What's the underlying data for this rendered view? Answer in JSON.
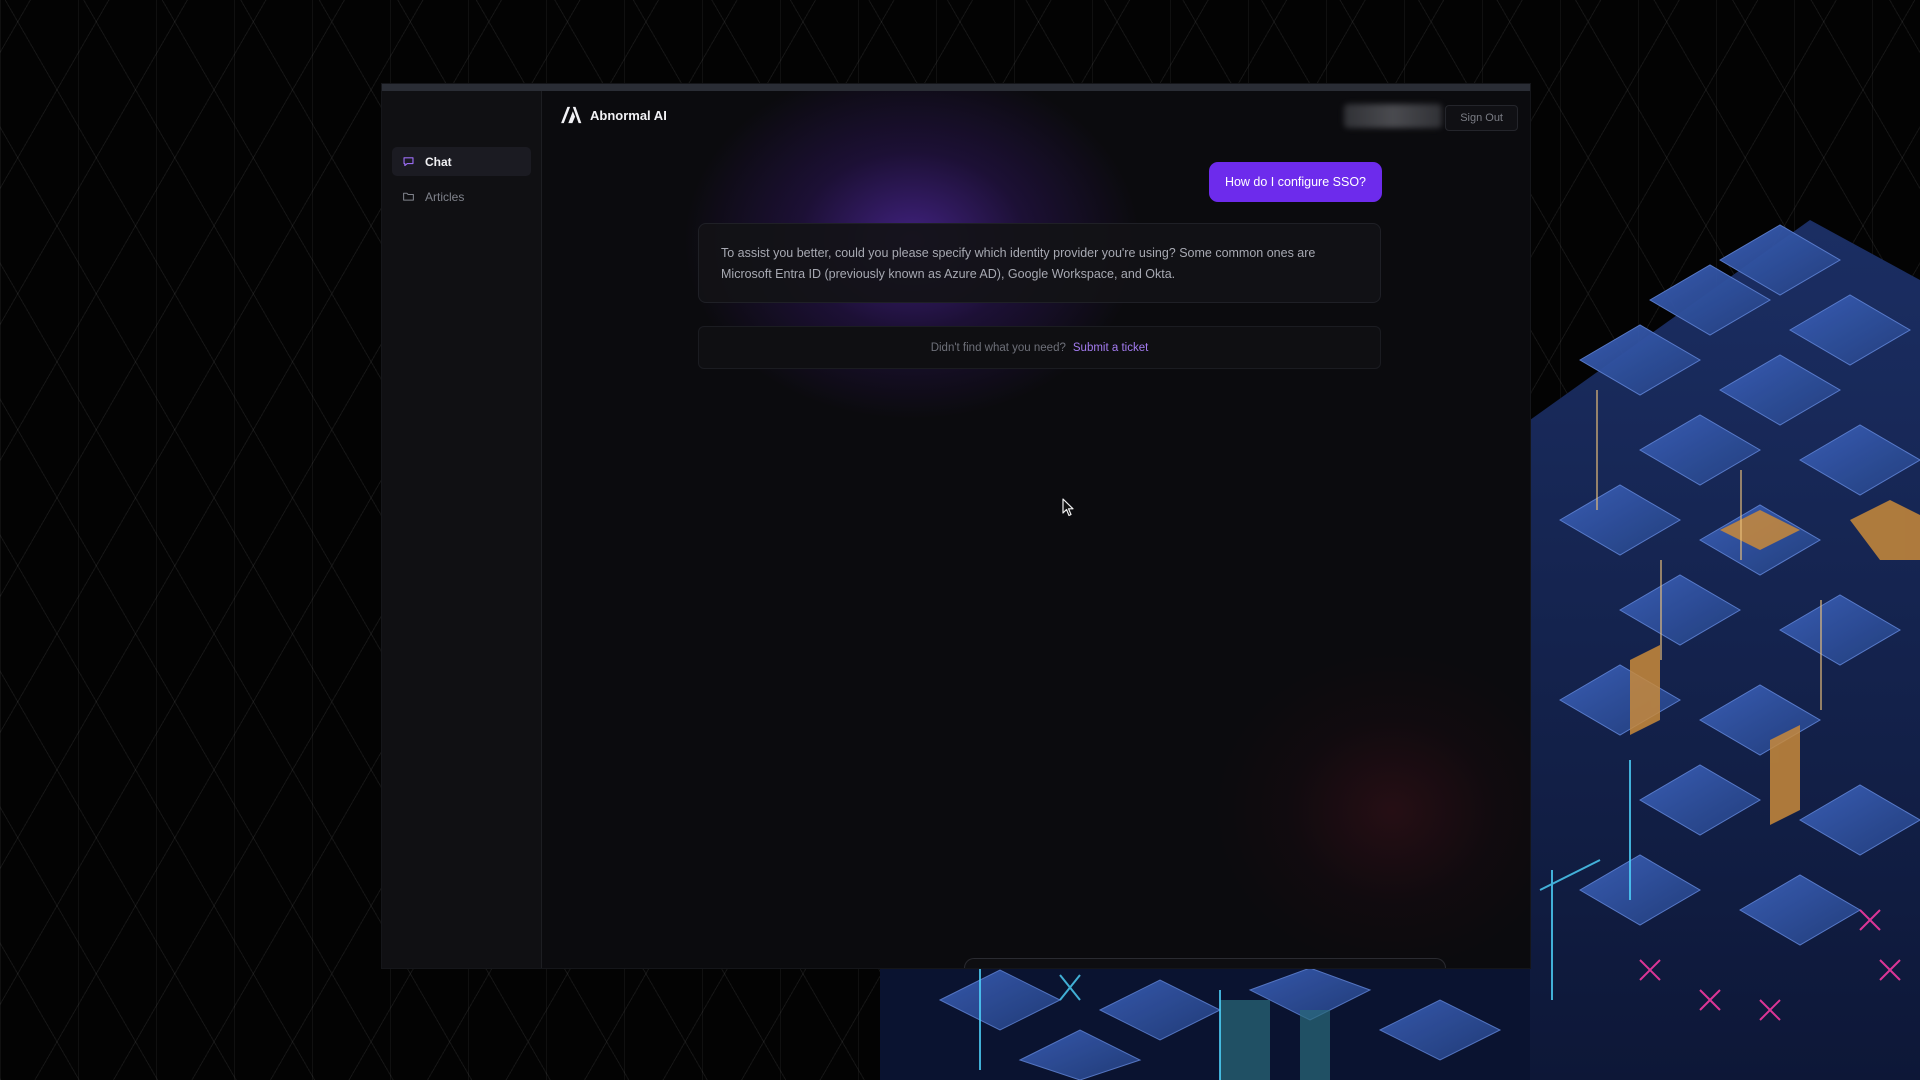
{
  "app": {
    "brand_name": "Abnormal AI",
    "accent_color": "#6d2bec",
    "link_color": "#a37bf0"
  },
  "sidebar": {
    "items": [
      {
        "label": "Chat",
        "icon": "message-square-icon",
        "active": true
      },
      {
        "label": "Articles",
        "icon": "folder-icon",
        "active": false
      }
    ]
  },
  "header": {
    "signout_label": "Sign Out"
  },
  "chat": {
    "user_message": "How do I configure SSO?",
    "assistant_message": "To assist you better, could you please specify which identity provider you're using? Some common ones are Microsoft Entra ID (previously known as Azure AD), Google Workspace, and Okta."
  },
  "support": {
    "question": "Didn't find what you need?",
    "link_label": "Submit a ticket"
  }
}
